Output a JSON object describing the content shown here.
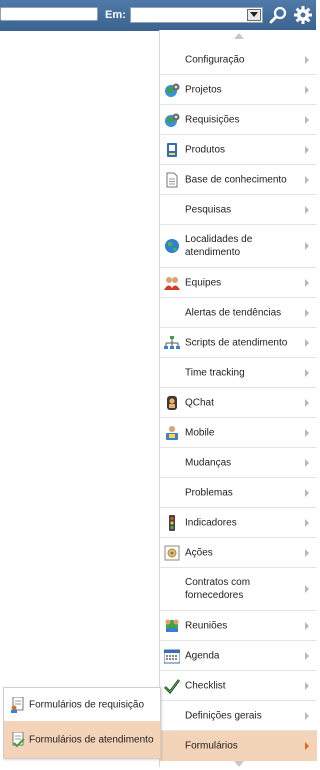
{
  "toolbar": {
    "search_value": "",
    "scope_label": "Em:",
    "scope_value": ""
  },
  "menu": {
    "items": [
      {
        "label": "Configuração",
        "icon": "none"
      },
      {
        "label": "Projetos",
        "icon": "projects-icon"
      },
      {
        "label": "Requisições",
        "icon": "requests-icon"
      },
      {
        "label": "Produtos",
        "icon": "products-icon"
      },
      {
        "label": "Base de conhecimento",
        "icon": "knowledge-base-icon"
      },
      {
        "label": "Pesquisas",
        "icon": "none"
      },
      {
        "label": "Localidades de atendimento",
        "icon": "globe-icon"
      },
      {
        "label": "Equipes",
        "icon": "team-icon"
      },
      {
        "label": "Alertas de tendências",
        "icon": "none"
      },
      {
        "label": "Scripts de atendimento",
        "icon": "flowchart-icon"
      },
      {
        "label": "Time tracking",
        "icon": "none"
      },
      {
        "label": "QChat",
        "icon": "chat-icon"
      },
      {
        "label": "Mobile",
        "icon": "mobile-icon"
      },
      {
        "label": "Mudanças",
        "icon": "none"
      },
      {
        "label": "Problemas",
        "icon": "none"
      },
      {
        "label": "Indicadores",
        "icon": "traffic-light-icon"
      },
      {
        "label": "Ações",
        "icon": "actions-icon"
      },
      {
        "label": "Contratos com fornecedores",
        "icon": "none"
      },
      {
        "label": "Reuniões",
        "icon": "meeting-icon"
      },
      {
        "label": "Agenda",
        "icon": "calendar-icon"
      },
      {
        "label": "Checklist",
        "icon": "checklist-icon"
      },
      {
        "label": "Definições gerais",
        "icon": "none"
      },
      {
        "label": "Formulários",
        "icon": "none",
        "active": true
      }
    ]
  },
  "submenu": {
    "items": [
      {
        "label": "Formulários de requisição",
        "icon": "request-form-icon"
      },
      {
        "label": "Formulários de atendimento",
        "icon": "service-form-icon",
        "hover": true
      }
    ]
  },
  "colors": {
    "topbar": "#4a72a0",
    "active_item": "#f4d4b8",
    "chevron": "#b8b8b8",
    "active_chevron": "#e06a1a"
  }
}
